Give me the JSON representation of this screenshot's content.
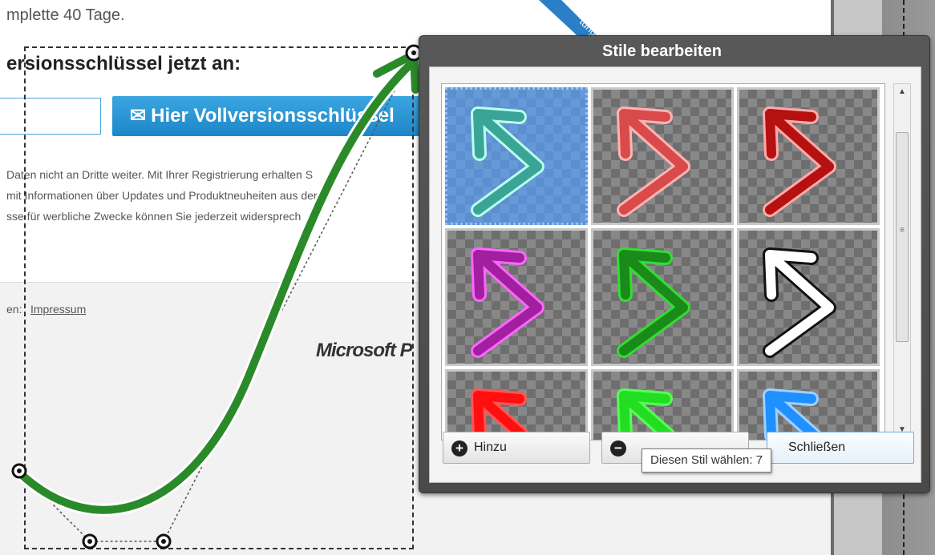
{
  "page": {
    "top_text": "mplette 40 Tage.",
    "heading": "ersionsschlüssel jetzt an:",
    "key_button_label": "Hier Vollversionsschlüssel",
    "mail_icon": "✉",
    "privacy_lines": [
      "Daten nicht an Dritte weiter. Mit Ihrer Registrierung erhalten S",
      "mit Informationen über Updates und Produktneuheiten aus der",
      "sse für werbliche Zwecke können Sie jederzeit widersprech"
    ],
    "impressum_prefix": "en:",
    "impressum_link": "Impressum",
    "ms_logo": "Microsoft P"
  },
  "ribbon": {
    "text": "tungen",
    "color": "#2a7fc6"
  },
  "dialog": {
    "title": "Stile bearbeiten",
    "styles": [
      {
        "color": "#3aa597",
        "outline": "#bfe",
        "selected": true
      },
      {
        "color": "#d94a4a",
        "outline": "#ffb3b3",
        "selected": false
      },
      {
        "color": "#b51111",
        "outline": "#ffaaaa",
        "selected": false
      },
      {
        "color": "#a21fa0",
        "outline": "#ff66ff",
        "selected": false
      },
      {
        "color": "#1a8a1a",
        "outline": "#33dd33",
        "selected": false
      },
      {
        "color": "#ffffff",
        "outline": "#111111",
        "selected": false
      },
      {
        "color": "#ff1010",
        "outline": "#ff5555",
        "selected": false
      },
      {
        "color": "#22dd22",
        "outline": "#55ff55",
        "selected": false
      },
      {
        "color": "#1e90ff",
        "outline": "#9fd0ff",
        "selected": false
      }
    ],
    "buttons": {
      "add": "Hinzu",
      "add_icon": "+",
      "remove_icon": "−",
      "close": "Schließen"
    },
    "tooltip": "Diesen Stil wählen: 7",
    "scroll_grip": "≡"
  },
  "arrow": {
    "color": "#2a8a2a"
  }
}
